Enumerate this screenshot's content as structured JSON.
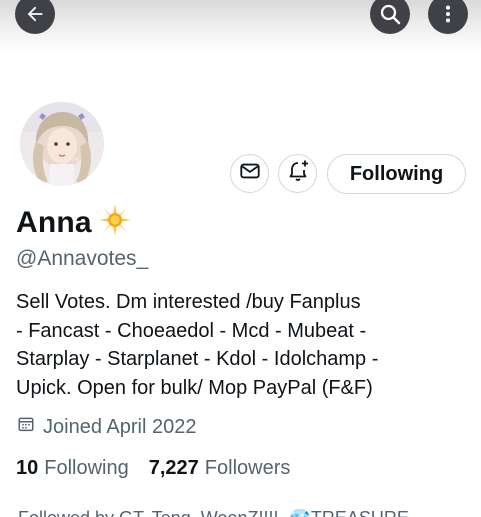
{
  "header": {
    "back_icon": "arrow-left-icon",
    "search_icon": "search-icon",
    "more_icon": "more-vertical-icon"
  },
  "profile": {
    "display_name": "Anna",
    "name_emoji": "🌟",
    "handle": "@Annavotes_",
    "bio_lines": [
      "Sell Votes. Dm interested /buy Fanplus",
      "- Fancast - Choeaedol - Mcd - Mubeat -",
      "Starplay - Starplanet - Kdol - Idolchamp -",
      "Upick. Open for bulk/ Mop PayPal (F&F)"
    ],
    "joined": "Joined April 2022",
    "following_count": "10",
    "following_label": "Following",
    "followers_count": "7,227",
    "followers_label": "Followers",
    "followed_by": "Followed by GT, Teng, WoonZ!!!!, 💎TREASURE"
  },
  "actions": {
    "message_icon": "envelope-icon",
    "notify_icon": "bell-plus-icon",
    "following_button": "Following"
  },
  "colors": {
    "text_primary": "#0f1419",
    "text_secondary": "#536471",
    "border": "#cfd9de",
    "overlay_button": "#3f4146"
  }
}
